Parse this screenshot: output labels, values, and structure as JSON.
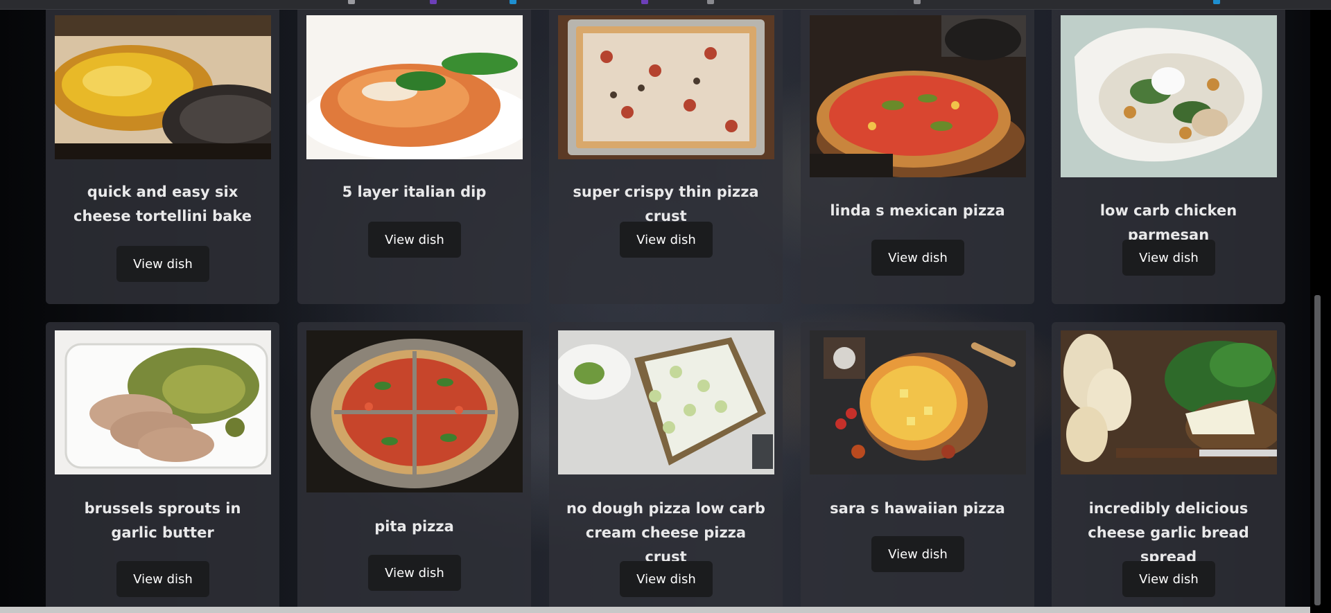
{
  "dishes": [
    {
      "title": "quick and easy six cheese tortellini bake",
      "button": "View dish"
    },
    {
      "title": "5 layer italian dip",
      "button": "View dish"
    },
    {
      "title": "super crispy thin pizza crust",
      "button": "View dish"
    },
    {
      "title": "linda s mexican pizza",
      "button": "View dish"
    },
    {
      "title": "low carb chicken parmesan",
      "button": "View dish"
    },
    {
      "title": "brussels sprouts in garlic butter",
      "button": "View dish"
    },
    {
      "title": "pita pizza",
      "button": "View dish"
    },
    {
      "title": "no dough pizza low carb cream cheese pizza crust",
      "button": "View dish"
    },
    {
      "title": "sara s hawaiian pizza",
      "button": "View dish"
    },
    {
      "title": "incredibly delicious cheese garlic bread spread",
      "button": "View dish"
    }
  ],
  "colors": {
    "card_background": "#2f3138",
    "button_background": "#1b1c1e",
    "title_text": "#e9e9ea",
    "page_background": "#07080b"
  }
}
